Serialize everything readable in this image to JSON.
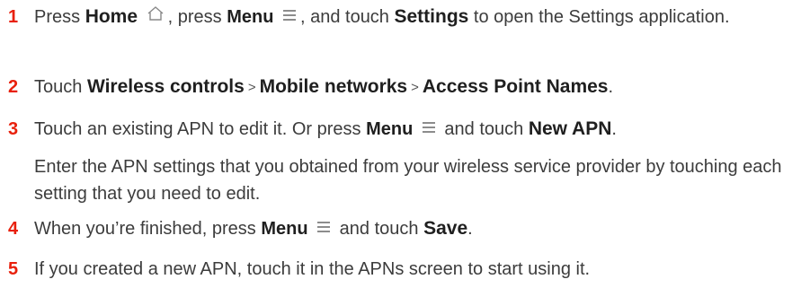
{
  "steps": [
    {
      "num": "1",
      "t1": "Press ",
      "home": "Home",
      "t2": ", press ",
      "menu": "Menu",
      "t3": ", and touch ",
      "settings": "Settings",
      "t4": " to open the Settings application."
    },
    {
      "num": "2",
      "t1": "Touch ",
      "c1": "Wireless controls",
      "sep": ">",
      "c2": "Mobile networks",
      "c3": "Access Point Names",
      "t2": "."
    },
    {
      "num": "3",
      "t1": "Touch an existing APN to edit it. Or press ",
      "menu": "Menu",
      "t2": " and touch ",
      "newapn": "New APN",
      "t3": ".",
      "para": "Enter the APN settings that you obtained from your wireless service provider by touching each setting that you need to edit."
    },
    {
      "num": "4",
      "t1": "When you’re finished, press ",
      "menu": "Menu",
      "t2": " and touch ",
      "save": "Save",
      "t3": "."
    },
    {
      "num": "5",
      "text": "If you created a new APN, touch it in the APNs screen to start using it."
    }
  ],
  "icons": {
    "home": "home-icon",
    "menu": "menu-icon"
  },
  "colors": {
    "step_number": "#e8200c",
    "text": "#3c3c3c"
  }
}
